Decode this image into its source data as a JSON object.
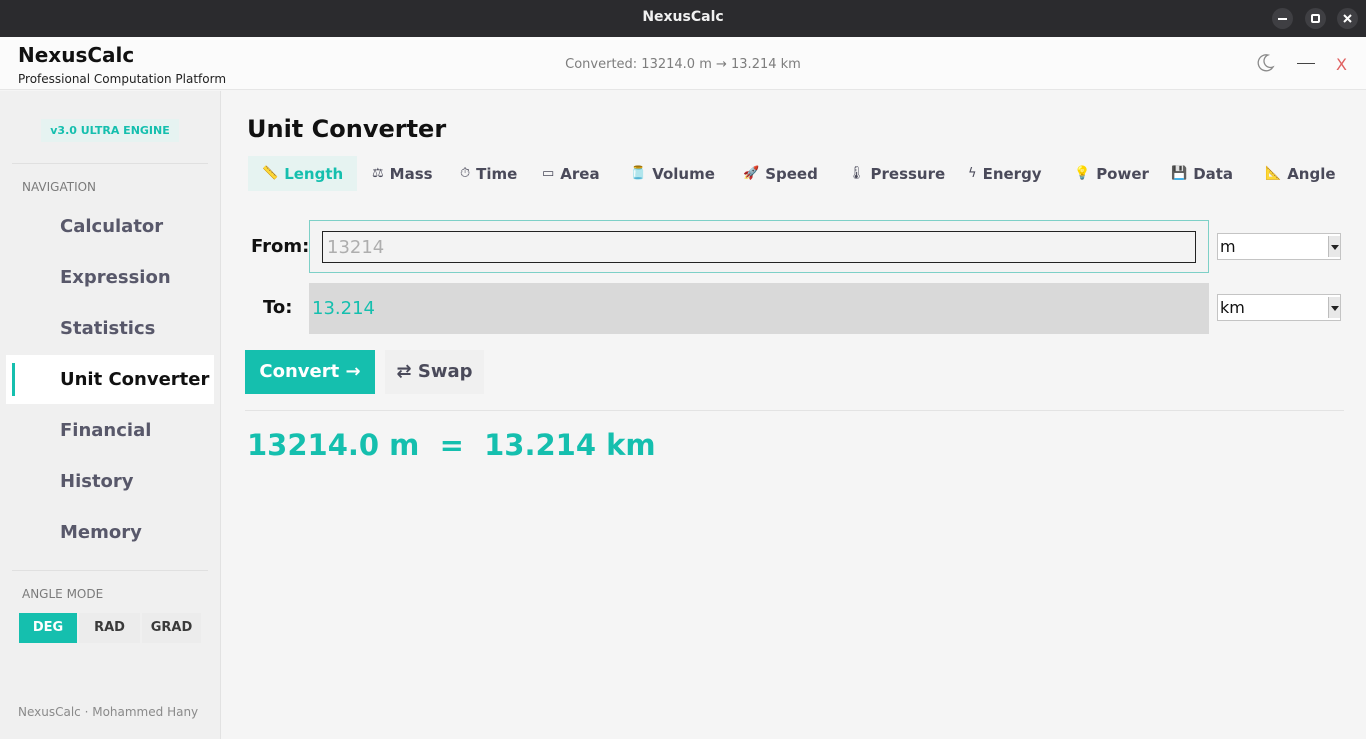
{
  "window": {
    "title": "NexusCalc"
  },
  "header": {
    "brand": "NexusCalc",
    "subtitle": "Professional Computation Platform",
    "status": "Converted: 13214.0 m → 13.214 km",
    "close_glyph": "X"
  },
  "sidebar": {
    "badge": "v3.0  ULTRA ENGINE",
    "nav_heading": "NAVIGATION",
    "nav_items": [
      {
        "label": "Calculator"
      },
      {
        "label": "Expression"
      },
      {
        "label": "Statistics"
      },
      {
        "label": "Unit Converter",
        "active": true
      },
      {
        "label": "Financial"
      },
      {
        "label": "History"
      },
      {
        "label": "Memory"
      }
    ],
    "angle_heading": "ANGLE MODE",
    "angle_modes": [
      {
        "label": "DEG",
        "active": true
      },
      {
        "label": "RAD"
      },
      {
        "label": "GRAD"
      }
    ],
    "footer": "NexusCalc · Mohammed Hany"
  },
  "main": {
    "title": "Unit Converter",
    "categories": [
      {
        "icon": "📏",
        "label": "Length",
        "active": true
      },
      {
        "icon": "⚖",
        "label": "Mass"
      },
      {
        "icon": "⏱",
        "label": "Time"
      },
      {
        "icon": "▭",
        "label": "Area"
      },
      {
        "icon": "🫙",
        "label": "Volume"
      },
      {
        "icon": "🚀",
        "label": "Speed"
      },
      {
        "icon": "🌡",
        "label": "Pressure"
      },
      {
        "icon": "ϟ",
        "label": "Energy"
      },
      {
        "icon": "💡",
        "label": "Power"
      },
      {
        "icon": "💾",
        "label": "Data"
      },
      {
        "icon": "📐",
        "label": "Angle"
      }
    ],
    "from": {
      "label": "From:",
      "value": "",
      "placeholder": "13214",
      "unit": "m"
    },
    "to": {
      "label": "To:",
      "value": "13.214",
      "unit": "km"
    },
    "convert_label": "Convert →",
    "swap_label": "⇄ Swap",
    "result": "13214.0 m  =  13.214 km"
  },
  "colors": {
    "accent": "#15bfae",
    "titlebar": "#2b2b2e",
    "output_bg": "#d9d9d9"
  }
}
